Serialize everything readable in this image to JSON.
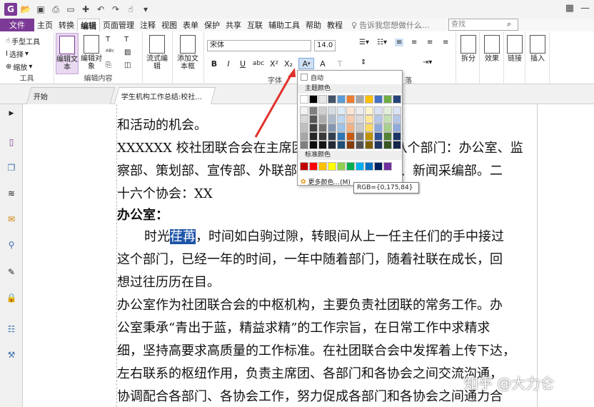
{
  "titlebar": {
    "watermark_text": "......."
  },
  "menubar": {
    "file": "文件",
    "tabs": [
      "主页",
      "转换",
      "编辑",
      "页面管理",
      "注释",
      "视图",
      "表单",
      "保护",
      "共享",
      "互联",
      "辅助工具",
      "帮助",
      "教程"
    ],
    "active_tab": "编辑",
    "tellme": "告诉我您想做什么...",
    "search_placeholder": "查找"
  },
  "ribbon": {
    "tools": {
      "hand": "手型工具",
      "select": "选择",
      "zoom": "缩放",
      "label": "工具"
    },
    "edit": {
      "edit_text": "编辑文本",
      "edit_object": "编辑对象",
      "label": "编辑内容"
    },
    "flow": {
      "flow_edit": "流式编辑"
    },
    "add": {
      "add_textbox": "添加文本框"
    },
    "font": {
      "family": "宋体",
      "size": "14.0",
      "label": "字体",
      "para_label": "落"
    },
    "right": {
      "split": "拆分",
      "effect": "效果",
      "link": "链接",
      "insert": "插入"
    }
  },
  "tabs": {
    "start": "开始",
    "doc": "学生机构工作总结:校社..."
  },
  "doc": {
    "lines": [
      "和活动的机会。",
      "XXXXXX 校社团联合会在主席团的领导下，下设八个部门：办公室、监",
      "察部、策划部、宣传部、外联部、编辑部、组织部、新闻采编部。二",
      "十六个协会：XX",
      "办公室：",
      "时光",
      "荏苒",
      "，时间如白驹过隙，转眼间从上一任主任们的手中接过",
      "这个部门，已经一年的时间，一年中随着部门，随着社联在成长，回",
      "想过往历历在目。",
      "办公室作为社团联合会的中枢机构，主要负责社团联的常务工作。办",
      "公室秉承“青出于蓝，精益求精”的工作宗旨，在日常工作中求精求",
      "细，坚持高要求高质量的工作标准。在社团联合会中发挥着上传下达，",
      "左右联系的枢纽作用，负责主席团、各部门和各协会之间交流沟通，",
      "协调配合各部门、各协会工作，努力促成各部门和各协会之间通力合"
    ]
  },
  "palette": {
    "auto": "自动",
    "theme_header": "主题颜色",
    "standard_header": "标准颜色",
    "more": "更多颜色...(M)",
    "tooltip": "RGB={0,175,84}",
    "theme_top": [
      "#ffffff",
      "#000000",
      "#e7e6e6",
      "#44546a",
      "#5b9bd5",
      "#ed7d31",
      "#a5a5a5",
      "#ffc000",
      "#4472c4",
      "#70ad47",
      "#264478"
    ],
    "theme_cols": [
      [
        "#f2f2f2",
        "#d9d9d9",
        "#bfbfbf",
        "#a6a6a6",
        "#7f7f7f"
      ],
      [
        "#7f7f7f",
        "#595959",
        "#404040",
        "#262626",
        "#0d0d0d"
      ],
      [
        "#d0cece",
        "#aeabab",
        "#757171",
        "#3b3838",
        "#161616"
      ],
      [
        "#d6dce4",
        "#adb9ca",
        "#8496b0",
        "#323f4f",
        "#222a35"
      ],
      [
        "#deebf6",
        "#bdd7ee",
        "#9dc3e6",
        "#2e75b5",
        "#1f4e79"
      ],
      [
        "#fbe5d5",
        "#f7cbac",
        "#f4b183",
        "#c55a11",
        "#843c0c"
      ],
      [
        "#ededed",
        "#dbdbdb",
        "#c9c9c9",
        "#7b7b7b",
        "#525252"
      ],
      [
        "#fff2cc",
        "#fee599",
        "#ffd965",
        "#bf9000",
        "#7f6000"
      ],
      [
        "#d9e2f3",
        "#b4c6e7",
        "#8eaadb",
        "#2f5496",
        "#1f3864"
      ],
      [
        "#e2efd9",
        "#c5e0b3",
        "#a8d08d",
        "#538135",
        "#375623"
      ],
      [
        "#dae3f3",
        "#b4c7e7",
        "#8faadc",
        "#1c3668",
        "#13254a"
      ]
    ],
    "standard": [
      "#c00000",
      "#ff0000",
      "#ffc000",
      "#ffff00",
      "#92d050",
      "#00b050",
      "#00b0f0",
      "#0070c0",
      "#002060",
      "#7030a0"
    ]
  },
  "watermark": "知乎 @大力仑",
  "colors": {
    "accent": "#7b3a96",
    "highlight": "#1f55a8",
    "arrow": "#e0312d"
  }
}
